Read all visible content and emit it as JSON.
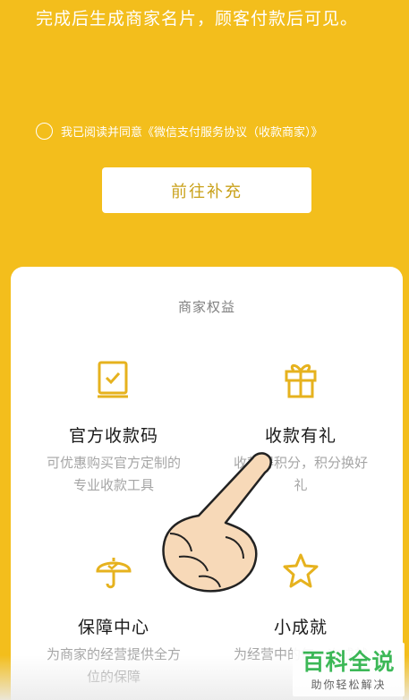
{
  "header": {
    "notice": "完成后生成商家名片，顾客付款后可见。"
  },
  "agreement": {
    "text": "我已阅读并同意《微信支付服务协议（收款商家）》",
    "checked": false
  },
  "actions": {
    "go_label": "前往补充"
  },
  "benefits": {
    "title": "商家权益",
    "items": [
      {
        "name": "官方收款码",
        "desc": "可优惠购买官方定制的专业收款工具",
        "icon": "receipt-book-icon"
      },
      {
        "name": "收款有礼",
        "desc": "收款得积分，积分换好礼",
        "icon": "gift-icon"
      },
      {
        "name": "保障中心",
        "desc": "为商家的经营提供全方位的保障",
        "icon": "umbrella-icon"
      },
      {
        "name": "小成就",
        "desc": "为经营中的每一次成就",
        "icon": "star-icon"
      }
    ]
  },
  "watermark": {
    "title": "百科全说",
    "subtitle": "助你轻松解决"
  },
  "colors": {
    "brand_yellow": "#F3BE1C",
    "icon_gold": "#E6B21E",
    "button_text": "#C9A11A"
  }
}
